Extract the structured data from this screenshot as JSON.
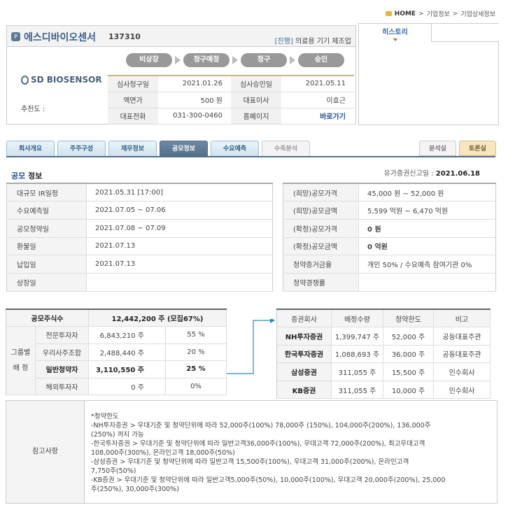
{
  "breadcrumb": {
    "home": "HOME",
    "sep": ">",
    "level1": "기업정보",
    "level2": "기업상세정보"
  },
  "company": {
    "icon": "P",
    "name": "에스디바이오센서",
    "code": "137310",
    "status_tag": "[진행]",
    "industry": "의료용 기기 제조업",
    "logo_text": "SD BIOSENSOR",
    "recommender_label": "추천도 :",
    "steps": [
      "비상장",
      "청구예정",
      "청구",
      "승인"
    ],
    "info": [
      {
        "k1": "심사청구일",
        "v1": "2021.01.26",
        "k2": "심사승인일",
        "v2": "2021.05.11"
      },
      {
        "k1": "액면가",
        "v1": "500 원",
        "k2": "대표이사",
        "v2": "이효근"
      },
      {
        "k1": "대표전화",
        "v1": "031-300-0460",
        "k2": "홈페이지",
        "v2": "바로가기"
      }
    ]
  },
  "history": {
    "tab_label": "히스토리"
  },
  "tabs": [
    "회사개요",
    "주주구성",
    "재무정보",
    "공모정보",
    "수요예측",
    "수축분석"
  ],
  "right_tabs": [
    "분석실",
    "토론실"
  ],
  "section": {
    "title_a": "공모",
    "title_b": " 정보",
    "filing_label": "유가증권신고일 :",
    "filing_date": "2021.06.18"
  },
  "schedule": [
    {
      "k": "대규모 IR일정",
      "v": "2021.05.31 [17:00]"
    },
    {
      "k": "수요예측일",
      "v": "2021.07.05 ~ 07.06"
    },
    {
      "k": "공모청약일",
      "v": "2021.07.08 ~ 07.09"
    },
    {
      "k": "환불일",
      "v": "2021.07.13"
    },
    {
      "k": "납입일",
      "v": "2021.07.13"
    },
    {
      "k": "상장일",
      "v": ""
    }
  ],
  "pricing": [
    {
      "k": "(희망)공모가격",
      "v": "45,000 원 ~ 52,000 원"
    },
    {
      "k": "(희망)공모금액",
      "v": "5,599 억원  ~ 6,470 억원"
    },
    {
      "k": "(확정)공모가격",
      "v": "0 원"
    },
    {
      "k": "(확정)공모금액",
      "v": "0 억원"
    },
    {
      "k": "청약증거금율",
      "v": "개인 50% / 수요예측 참여기관 0%"
    },
    {
      "k": "청약경쟁률",
      "v": ""
    }
  ],
  "allocation": {
    "total_label": "공모주식수",
    "total_value": "12,442,200 주 (모집67%)",
    "group_label_1": "그룹별",
    "group_label_2": "배 정",
    "rows": [
      {
        "name": "전문투자자",
        "shares": "6,843,210 주",
        "pct": "55 %"
      },
      {
        "name": "우리사주조합",
        "shares": "2,488,440 주",
        "pct": "20 %"
      },
      {
        "name": "일반청약자",
        "shares": "3,110,550 주",
        "pct": "25 %"
      },
      {
        "name": "해외투자자",
        "shares": "0 주",
        "pct": "0%"
      }
    ]
  },
  "underwriters": {
    "headers": [
      "증권회사",
      "배정수량",
      "청약한도",
      "비고"
    ],
    "rows": [
      {
        "firm": "NH투자증권",
        "qty": "1,399,747 주",
        "limit": "52,000 주",
        "note": "공동대표주관"
      },
      {
        "firm": "한국투자증권",
        "qty": "1,088,693 주",
        "limit": "36,000 주",
        "note": "공동대표주관"
      },
      {
        "firm": "삼성증권",
        "qty": "311,055 주",
        "limit": "15,500 주",
        "note": "인수회사"
      },
      {
        "firm": "KB증권",
        "qty": "311,055 주",
        "limit": "10,000 주",
        "note": "인수회사"
      }
    ]
  },
  "note": {
    "label": "참고사항",
    "text": "*청약한도\n-NH투자증권 > 우대기준 및 청약단위에 따라 52,000주(100%) 78,000주 (150%), 104,000주(200%), 136,000주\n(250%) 까지 가능\n-한국투자증권 > 우대기준 및 청약단위에 따라 일반고객36,000주(100%), 우대고객 72,000주(200%), 최고우대고객\n108,000주(300%), 온라인고객 18,000주(50%)\n-삼성증권 > 우대기준 및 청약단위에 따라 일반고객 15,500주(100%), 우대고객 31,000주(200%), 온라인고객\n7,750주(50%)\n-KB증권 > 우대기준 및 청약단위에 따라 일반고객5,000주(50%), 10,000주(100%), 우대고객 20,000주(200%), 25,000\n주(250%), 30,000주(300%)"
  }
}
